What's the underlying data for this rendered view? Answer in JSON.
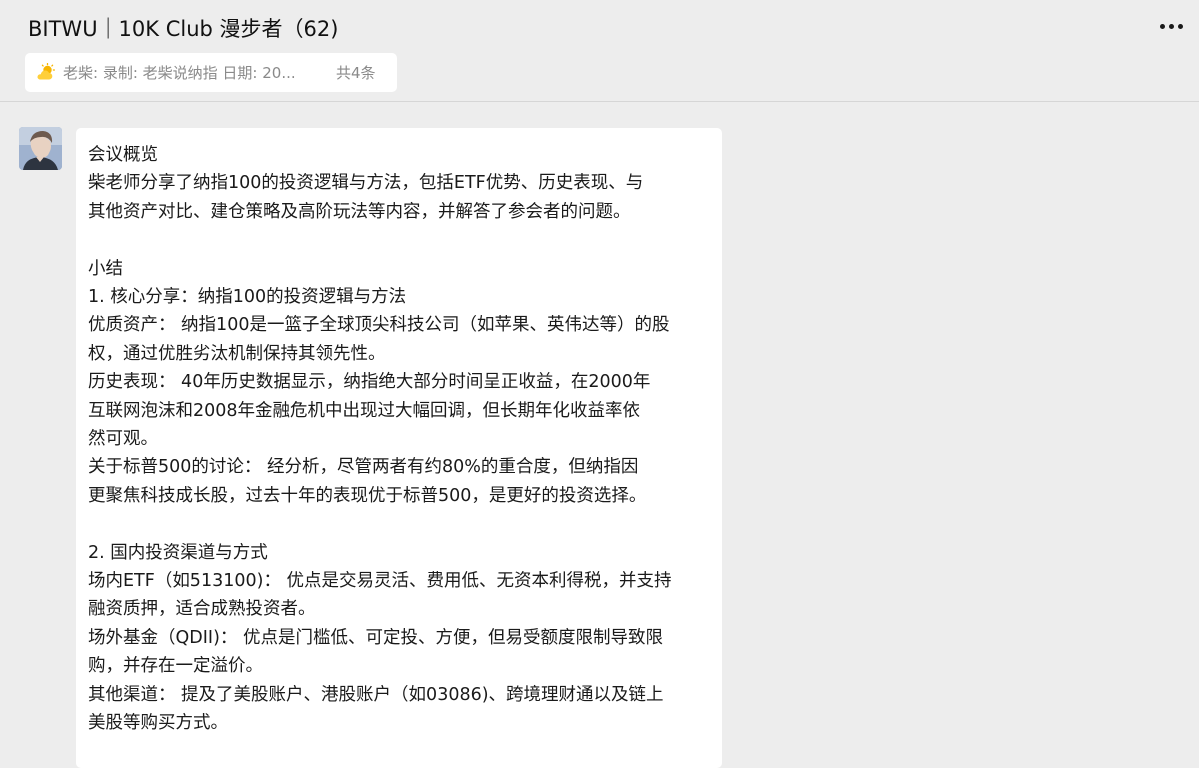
{
  "header": {
    "title": "BITWU｜10K Club 漫步者（62)",
    "more_icon": "more-dots-icon"
  },
  "pinned": {
    "icon": "sun-cloud-icon",
    "text": "老柴: 录制: 老柴说纳指 日期: 20...",
    "count": "共4条"
  },
  "message": {
    "avatar_icon": "user-avatar",
    "lines": [
      "会议概览",
      "柴老师分享了纳指100的投资逻辑与方法，包括ETF优势、历史表现、与",
      "其他资产对比、建仓策略及高阶玩法等内容，并解答了参会者的问题。",
      "",
      "小结",
      "1. 核心分享：纳指100的投资逻辑与方法",
      "优质资产： 纳指100是一篮子全球顶尖科技公司（如苹果、英伟达等）的股",
      "权，通过优胜劣汰机制保持其领先性。",
      "历史表现： 40年历史数据显示，纳指绝大部分时间呈正收益，在2000年",
      "互联网泡沫和2008年金融危机中出现过大幅回调，但长期年化收益率依",
      "然可观。",
      "关于标普500的讨论： 经分析，尽管两者有约80%的重合度，但纳指因",
      "更聚焦科技成长股，过去十年的表现优于标普500，是更好的投资选择。",
      "",
      "2. 国内投资渠道与方式",
      "场内ETF（如513100)： 优点是交易灵活、费用低、无资本利得税，并支持",
      "融资质押，适合成熟投资者。",
      "场外基金（QDII)： 优点是门槛低、可定投、方便，但易受额度限制导致限",
      "购，并存在一定溢价。",
      "其他渠道： 提及了美股账户、港股账户（如03086)、跨境理财通以及链上",
      "美股等购买方式。"
    ]
  }
}
